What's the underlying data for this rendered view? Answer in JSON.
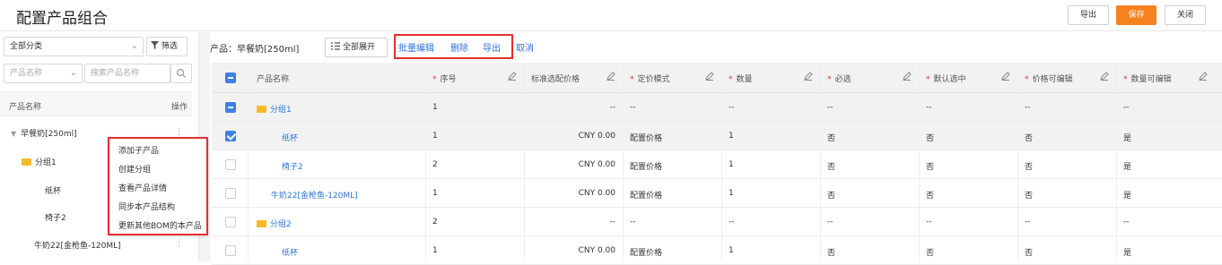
{
  "header": {
    "title": "配置产品组合",
    "export_label": "导出",
    "save_label": "保存",
    "close_label": "关闭"
  },
  "left": {
    "category_value": "全部分类",
    "filter_label": "筛选",
    "field_select": "产品名称",
    "search_placeholder": "搜索产品名称",
    "col_name": "产品名称",
    "col_op": "操作",
    "tree": {
      "root": "早餐奶[250ml]",
      "group1": "分组1",
      "child1": "纸杯",
      "child2": "椅子2",
      "child3": "牛奶22[金枪鱼-120ML]"
    },
    "context_menu": [
      "添加子产品",
      "创建分组",
      "查看产品详情",
      "同步本产品结构",
      "更新其他BOM的本产品"
    ]
  },
  "toolbar": {
    "product_label": "产品：",
    "product_value": "早餐奶[250ml]",
    "expand_all": "全部展开",
    "batch_edit": "批量编辑",
    "delete": "删除",
    "export": "导出",
    "cancel": "取消"
  },
  "table": {
    "headers": [
      "产品名称",
      "序号",
      "标准选配价格",
      "定价模式",
      "数量",
      "必选",
      "默认选中",
      "价格可编辑",
      "数量可编辑"
    ],
    "rows": [
      {
        "name": "分组1",
        "seq": "1",
        "price": "--",
        "mode": "--",
        "qty": "--",
        "required": "--",
        "default": "--",
        "price_edit": "--",
        "qty_edit": "--"
      },
      {
        "name": "纸杯",
        "seq": "1",
        "price": "CNY 0.00",
        "mode": "配置价格",
        "qty": "1",
        "required": "否",
        "default": "否",
        "price_edit": "否",
        "qty_edit": "是"
      },
      {
        "name": "椅子2",
        "seq": "2",
        "price": "CNY 0.00",
        "mode": "配置价格",
        "qty": "1",
        "required": "否",
        "default": "否",
        "price_edit": "否",
        "qty_edit": "是"
      },
      {
        "name": "牛奶22[金枪鱼-120ML]",
        "seq": "1",
        "price": "CNY 0.00",
        "mode": "配置价格",
        "qty": "1",
        "required": "否",
        "default": "否",
        "price_edit": "否",
        "qty_edit": "是"
      },
      {
        "name": "分组2",
        "seq": "2",
        "price": "--",
        "mode": "--",
        "qty": "--",
        "required": "--",
        "default": "--",
        "price_edit": "--",
        "qty_edit": "--"
      },
      {
        "name": "纸杯",
        "seq": "1",
        "price": "CNY 0.00",
        "mode": "配置价格",
        "qty": "1",
        "required": "否",
        "default": "否",
        "price_edit": "否",
        "qty_edit": "是"
      }
    ]
  },
  "colors": {
    "accent": "#2f74d8",
    "save": "#f5821f",
    "highlight": "#e62e2e",
    "folder": "#f7ba2a"
  }
}
